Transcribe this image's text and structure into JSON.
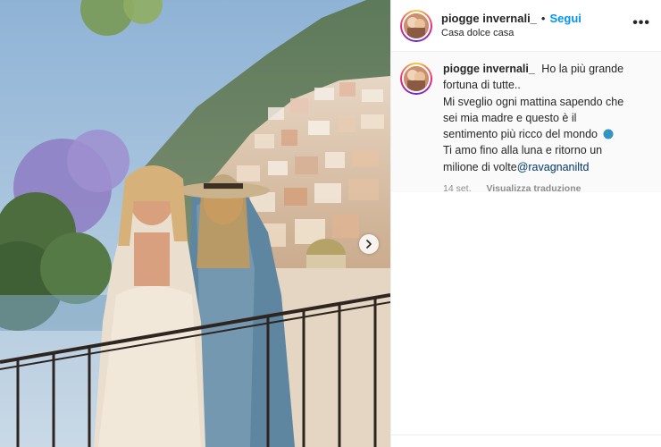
{
  "header": {
    "username": "piogge invernali_",
    "separator": "•",
    "follow_label": "Segui",
    "location": "Casa dolce casa",
    "more_label": "•••"
  },
  "caption": {
    "username": "piogge invernali_",
    "lines": [
      "Ho la più grande",
      "fortuna di tutte..",
      "Mi sveglio ogni mattina sapendo che",
      "sei mia madre e questo è il",
      "sentimento più ricco del mondo",
      "Ti amo fino alla luna e ritorno un",
      "milione di volte"
    ],
    "mention": "@ravagnaniltd",
    "emoji": "globe-emoji"
  },
  "meta": {
    "date": "14 set.",
    "translate_label": "Visualizza traduzione"
  },
  "icons": {
    "next": "chevron-right-icon",
    "more": "more-options-icon"
  },
  "colors": {
    "follow": "#0095f6",
    "mention": "#00376b",
    "muted": "#8e8e8e"
  }
}
